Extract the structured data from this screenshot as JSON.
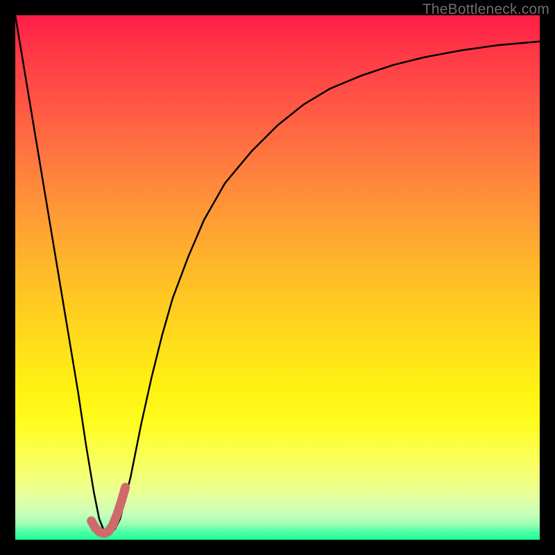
{
  "watermark": {
    "text": "TheBottleneck.com"
  },
  "chart_data": {
    "type": "line",
    "title": "",
    "xlabel": "",
    "ylabel": "",
    "xlim": [
      0,
      100
    ],
    "ylim": [
      0,
      100
    ],
    "grid": false,
    "legend": false,
    "series": [
      {
        "name": "bottleneck-curve",
        "color": "#000000",
        "width": 2.5,
        "x": [
          0,
          2,
          4,
          6,
          8,
          10,
          12,
          13.5,
          15,
          16,
          17,
          18,
          19,
          20,
          22,
          24,
          26,
          28,
          30,
          33,
          36,
          40,
          45,
          50,
          55,
          60,
          66,
          72,
          78,
          85,
          92,
          100
        ],
        "values": [
          100,
          88,
          76,
          64,
          52,
          40,
          28,
          18,
          9,
          4,
          1.5,
          1.2,
          2,
          4,
          12,
          22,
          31,
          39,
          46,
          54,
          61,
          68,
          74,
          79,
          83,
          86,
          88.5,
          90.5,
          92,
          93.3,
          94.3,
          95
        ]
      },
      {
        "name": "highlight-j",
        "color": "#cf6a6a",
        "width": 13,
        "linecap": "round",
        "x": [
          14.5,
          15.3,
          16.2,
          17.0,
          17.8,
          18.6,
          19.4,
          20.2,
          21.0
        ],
        "values": [
          3.6,
          2.2,
          1.4,
          1.2,
          1.6,
          2.8,
          4.8,
          7.2,
          10.0
        ]
      }
    ],
    "background_gradient": {
      "stops": [
        {
          "pos": 0.0,
          "color": "#ff1e47"
        },
        {
          "pos": 0.3,
          "color": "#ff7a3f"
        },
        {
          "pos": 0.55,
          "color": "#ffd21e"
        },
        {
          "pos": 0.78,
          "color": "#fffc20"
        },
        {
          "pos": 0.95,
          "color": "#c8ffb8"
        },
        {
          "pos": 1.0,
          "color": "#1eff92"
        }
      ]
    }
  }
}
